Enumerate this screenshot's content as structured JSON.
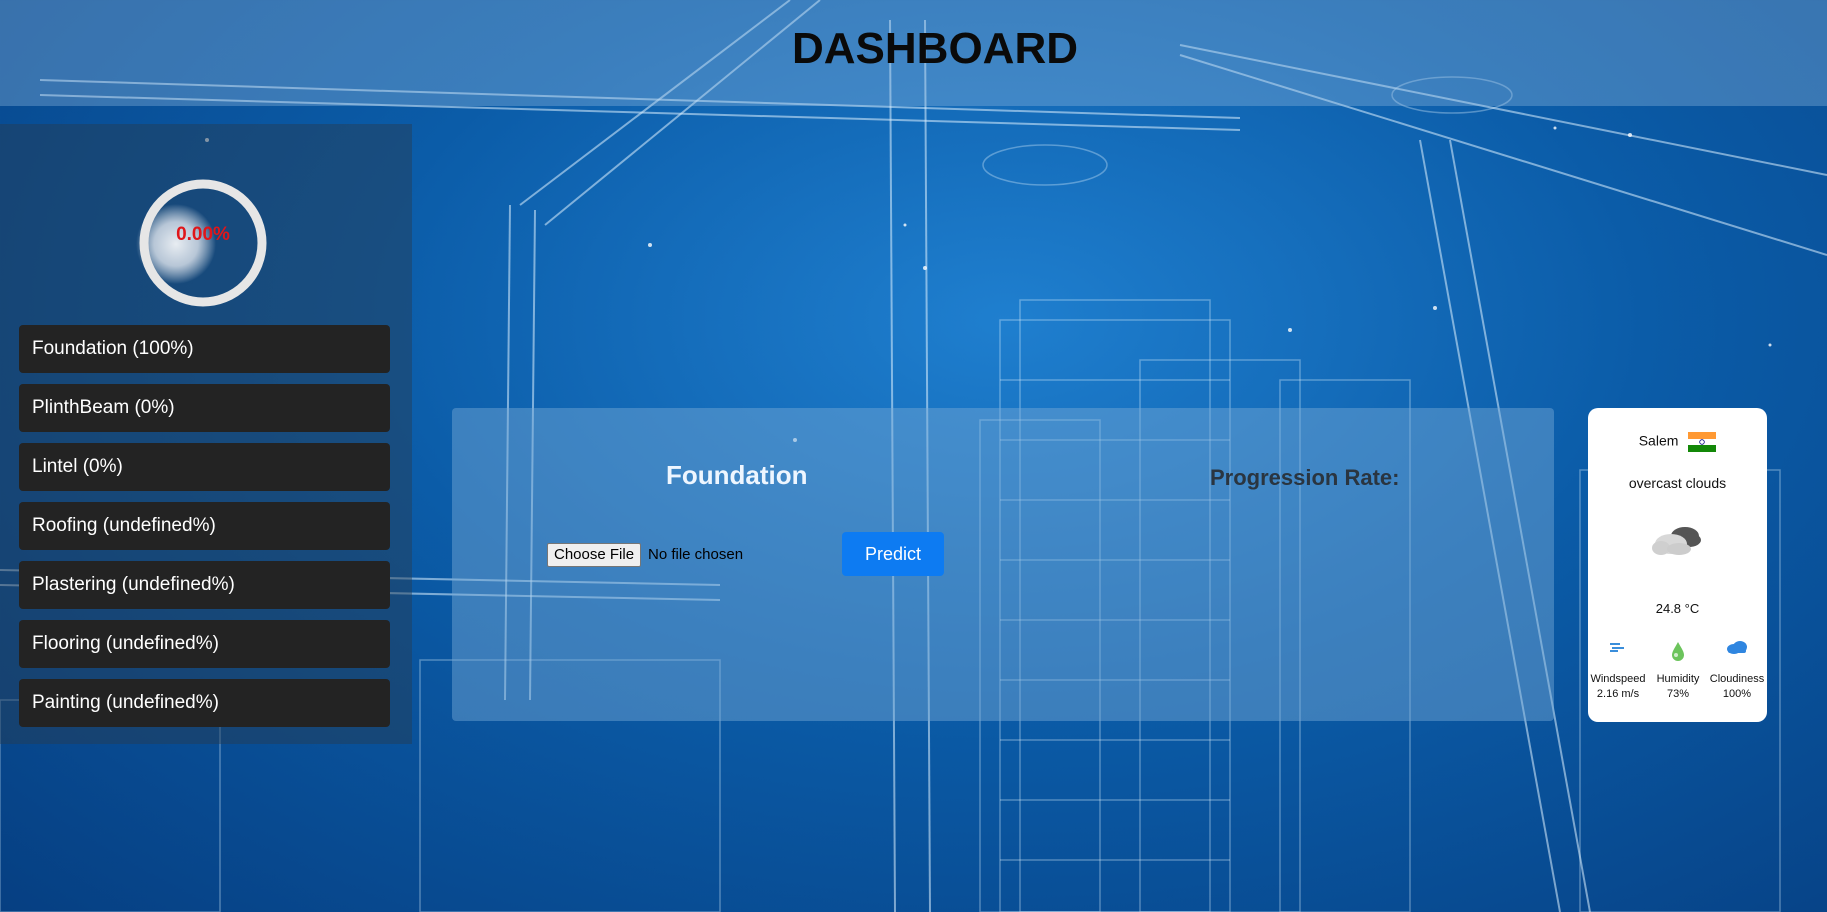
{
  "header": {
    "title": "DASHBOARD"
  },
  "gauge": {
    "percent_label": "0.00%",
    "percent": 0
  },
  "stages": [
    {
      "label": "Foundation (100%)"
    },
    {
      "label": "PlinthBeam (0%)"
    },
    {
      "label": "Lintel (0%)"
    },
    {
      "label": "Roofing (undefined%)"
    },
    {
      "label": "Plastering (undefined%)"
    },
    {
      "label": "Flooring (undefined%)"
    },
    {
      "label": "Painting (undefined%)"
    }
  ],
  "panel": {
    "title": "Foundation",
    "progression_label": "Progression Rate:",
    "file_button": "Choose File",
    "file_status": "No file chosen",
    "predict_button": "Predict"
  },
  "weather": {
    "city": "Salem",
    "country_flag": "india-flag-icon",
    "description": "overcast clouds",
    "icon": "overcast-clouds-icon",
    "temperature": "24.8 °C",
    "stats": [
      {
        "label": "Windspeed",
        "value": "2.16 m/s",
        "icon": "wind-icon"
      },
      {
        "label": "Humidity",
        "value": "73%",
        "icon": "humidity-icon"
      },
      {
        "label": "Cloudiness",
        "value": "100%",
        "icon": "cloud-icon"
      }
    ]
  },
  "colors": {
    "predict_button": "#0d7bf2",
    "gauge_text": "#e0161a",
    "stage_bg": "#232323"
  }
}
